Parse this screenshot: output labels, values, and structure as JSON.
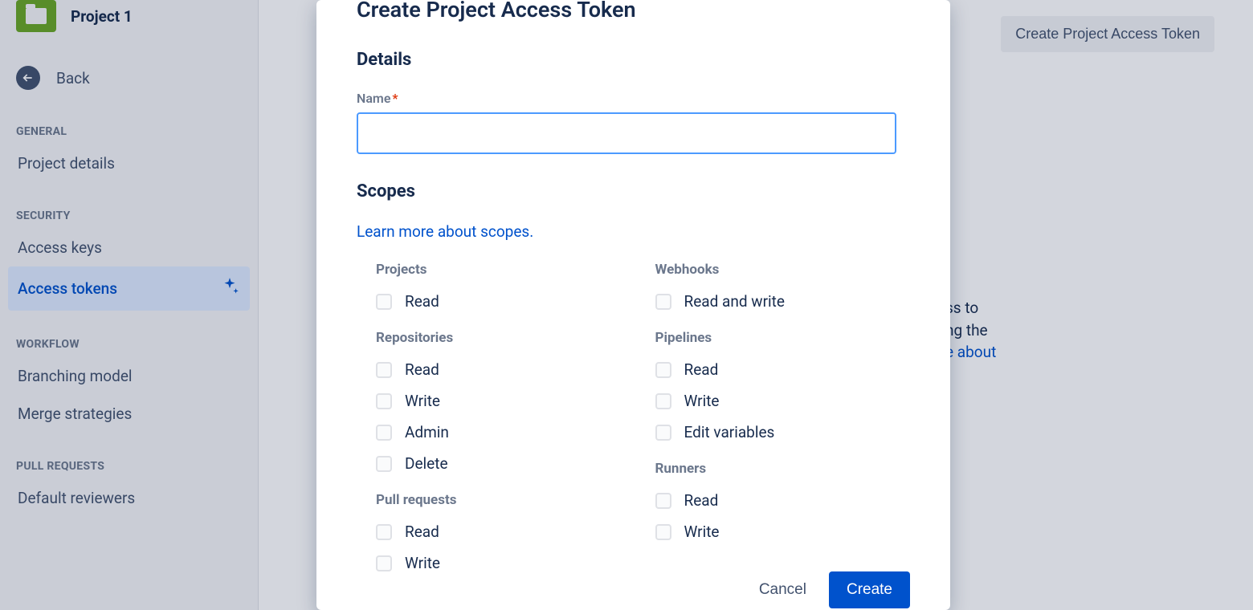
{
  "sidebar": {
    "project_title": "Project 1",
    "back_label": "Back",
    "sections": {
      "general": {
        "heading": "GENERAL",
        "items": [
          "Project details"
        ]
      },
      "security": {
        "heading": "SECURITY",
        "items": [
          "Access keys",
          "Access tokens"
        ]
      },
      "workflow": {
        "heading": "WORKFLOW",
        "items": [
          "Branching model",
          "Merge strategies"
        ]
      },
      "pull_requests": {
        "heading": "PULL REQUESTS",
        "items": [
          "Default reviewers"
        ]
      }
    }
  },
  "main": {
    "create_button": "Create Project Access Token",
    "bg_text_parts": [
      "ss to",
      "ng the",
      "e about"
    ]
  },
  "modal": {
    "title": "Create Project Access Token",
    "details_heading": "Details",
    "name_label": "Name",
    "name_value": "",
    "scopes_heading": "Scopes",
    "scopes_link": "Learn more about scopes.",
    "scope_groups": {
      "projects": {
        "title": "Projects",
        "items": [
          "Read"
        ]
      },
      "repositories": {
        "title": "Repositories",
        "items": [
          "Read",
          "Write",
          "Admin",
          "Delete"
        ]
      },
      "pull_requests": {
        "title": "Pull requests",
        "items": [
          "Read",
          "Write"
        ]
      },
      "webhooks": {
        "title": "Webhooks",
        "items": [
          "Read and write"
        ]
      },
      "pipelines": {
        "title": "Pipelines",
        "items": [
          "Read",
          "Write",
          "Edit variables"
        ]
      },
      "runners": {
        "title": "Runners",
        "items": [
          "Read",
          "Write"
        ]
      }
    },
    "cancel": "Cancel",
    "create": "Create"
  }
}
